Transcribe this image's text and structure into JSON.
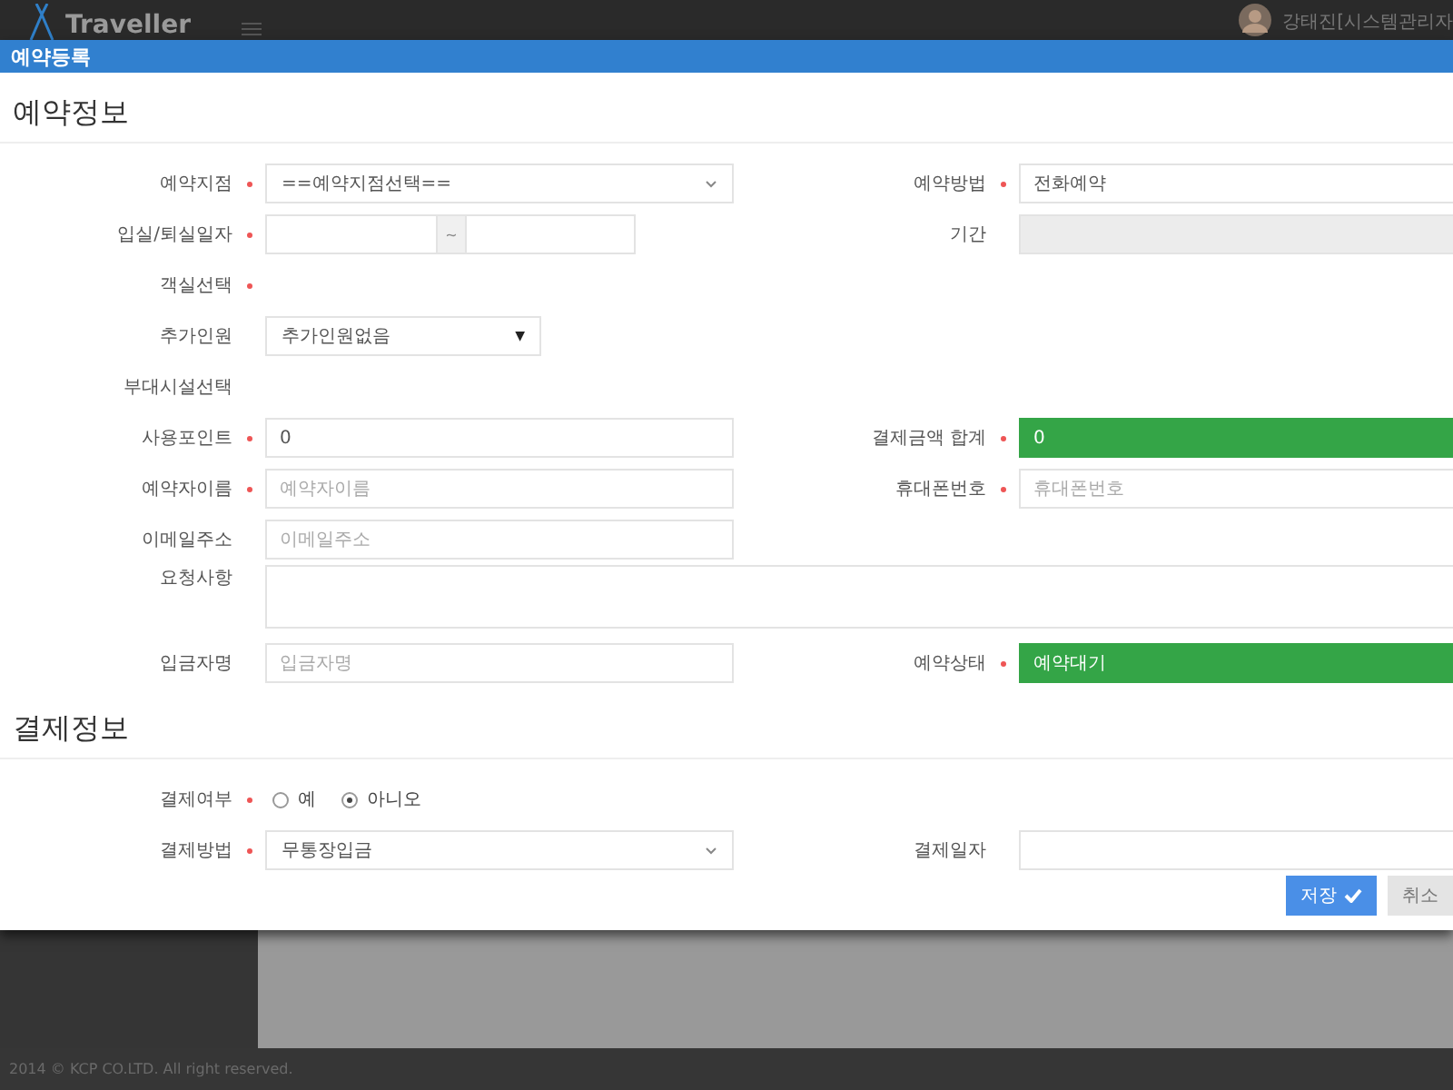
{
  "topbar": {
    "logo": "Traveller",
    "user_name": "강태진[시스템관리자"
  },
  "modal": {
    "title": "예약등록",
    "sections": [
      {
        "title": "예약정보",
        "rows": [
          {
            "left": {
              "label": "예약지점",
              "required": true,
              "field": {
                "kind": "select",
                "value": "==예약지점선택=="
              }
            },
            "right": {
              "label": "예약방법",
              "required": true,
              "field": {
                "kind": "text",
                "value": "전화예약"
              }
            }
          },
          {
            "left": {
              "label": "입실/퇴실일자",
              "required": true,
              "field": {
                "kind": "daterange",
                "separator": "~"
              }
            },
            "right": {
              "label": "기간",
              "required": false,
              "field": {
                "kind": "disabled"
              }
            }
          },
          {
            "left": {
              "label": "객실선택",
              "required": true,
              "field": {
                "kind": "none"
              }
            }
          },
          {
            "left": {
              "label": "추가인원",
              "required": false,
              "field": {
                "kind": "native-select",
                "value": "추가인원없음",
                "arrow": "▼"
              }
            }
          },
          {
            "left": {
              "label": "부대시설선택",
              "required": false,
              "field": {
                "kind": "none"
              }
            }
          },
          {
            "left": {
              "label": "사용포인트",
              "required": true,
              "field": {
                "kind": "text",
                "value": "0"
              }
            },
            "right": {
              "label": "결제금액 합계",
              "required": true,
              "field": {
                "kind": "highlight",
                "value": "0"
              }
            }
          },
          {
            "left": {
              "label": "예약자이름",
              "required": true,
              "field": {
                "kind": "text",
                "placeholder": "예약자이름"
              }
            },
            "right": {
              "label": "휴대폰번호",
              "required": true,
              "field": {
                "kind": "text",
                "placeholder": "휴대폰번호"
              }
            }
          },
          {
            "left": {
              "label": "이메일주소",
              "required": false,
              "field": {
                "kind": "text",
                "placeholder": "이메일주소"
              }
            }
          },
          {
            "left": {
              "label": "요청사항",
              "required": false,
              "field": {
                "kind": "textarea"
              }
            }
          },
          {
            "left": {
              "label": "입금자명",
              "required": false,
              "field": {
                "kind": "text",
                "placeholder": "입금자명"
              }
            },
            "right": {
              "label": "예약상태",
              "required": true,
              "field": {
                "kind": "highlight",
                "value": "예약대기"
              }
            }
          }
        ]
      },
      {
        "title": "결제정보",
        "rows": [
          {
            "left": {
              "label": "결제여부",
              "required": true,
              "field": {
                "kind": "radio",
                "options": [
                  {
                    "label": "예",
                    "selected": false
                  },
                  {
                    "label": "아니오",
                    "selected": true
                  }
                ]
              }
            }
          },
          {
            "left": {
              "label": "결제방법",
              "required": true,
              "field": {
                "kind": "select",
                "value": "무통장입금"
              }
            },
            "right": {
              "label": "결제일자",
              "required": false,
              "field": {
                "kind": "text"
              }
            }
          }
        ]
      }
    ],
    "buttons": [
      {
        "kind": "primary",
        "label": "저장"
      },
      {
        "kind": "secondary",
        "label": "취소"
      }
    ]
  },
  "footer": "2014 © KCP CO.LTD. All right reserved."
}
